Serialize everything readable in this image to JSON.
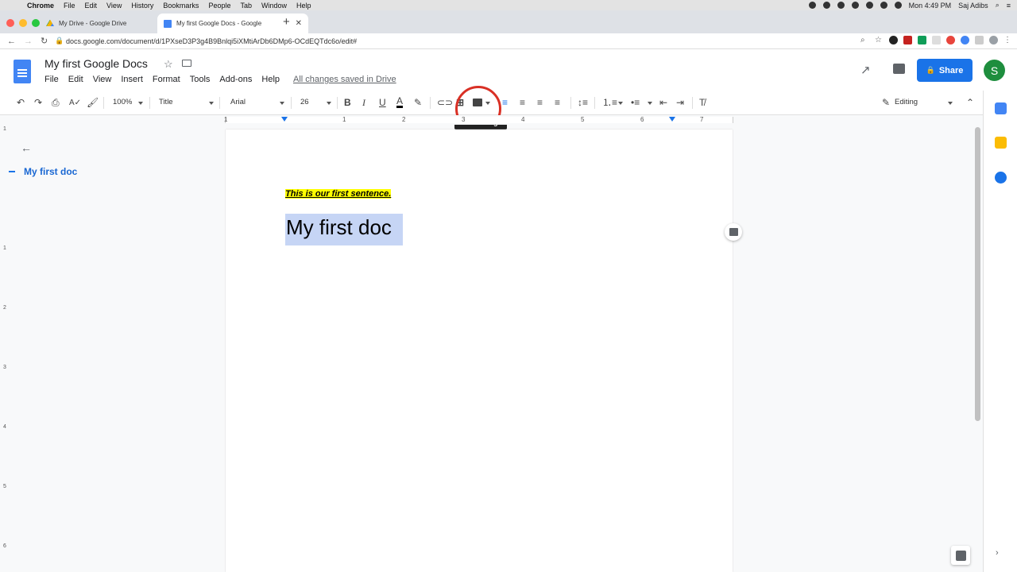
{
  "mac_menubar": {
    "items": [
      "Chrome",
      "File",
      "Edit",
      "View",
      "History",
      "Bookmarks",
      "People",
      "Tab",
      "Window",
      "Help"
    ],
    "clock": "Mon 4:49 PM",
    "user": "Saj Adibs"
  },
  "browser": {
    "tabs": [
      {
        "title": "My Drive - Google Drive",
        "active": false
      },
      {
        "title": "My first Google Docs - Google",
        "active": true
      }
    ],
    "url": "docs.google.com/document/d/1PXseD3P3g4B9Bnlqi5iXMtiArDb6DMp6-OCdEQTdc6o/edit#"
  },
  "doc": {
    "title": "My first Google Docs",
    "menus": [
      "File",
      "Edit",
      "View",
      "Insert",
      "Format",
      "Tools",
      "Add-ons",
      "Help"
    ],
    "save_status": "All changes saved in Drive",
    "share_label": "Share",
    "avatar_letter": "S"
  },
  "toolbar": {
    "zoom": "100%",
    "style": "Title",
    "font": "Arial",
    "size": "26",
    "bold": "B",
    "italic": "I",
    "underline": "U",
    "text_color": "A",
    "mode": "Editing",
    "tooltip": "Insert image"
  },
  "ruler": {
    "numbers": [
      "1",
      "1",
      "2",
      "3",
      "4",
      "5",
      "6",
      "7"
    ]
  },
  "vruler": {
    "numbers": [
      "1",
      "1",
      "2",
      "3",
      "4",
      "5",
      "6"
    ]
  },
  "outline": {
    "item": "My first doc"
  },
  "content": {
    "sentence": "This is our first sentence.",
    "heading": "My first doc"
  },
  "colors": {
    "accent": "#1a73e8",
    "avatar": "#1e8e3e",
    "highlight": "#ffff00",
    "selection": "#c6d5f5",
    "annotation_circle": "#d93025"
  }
}
